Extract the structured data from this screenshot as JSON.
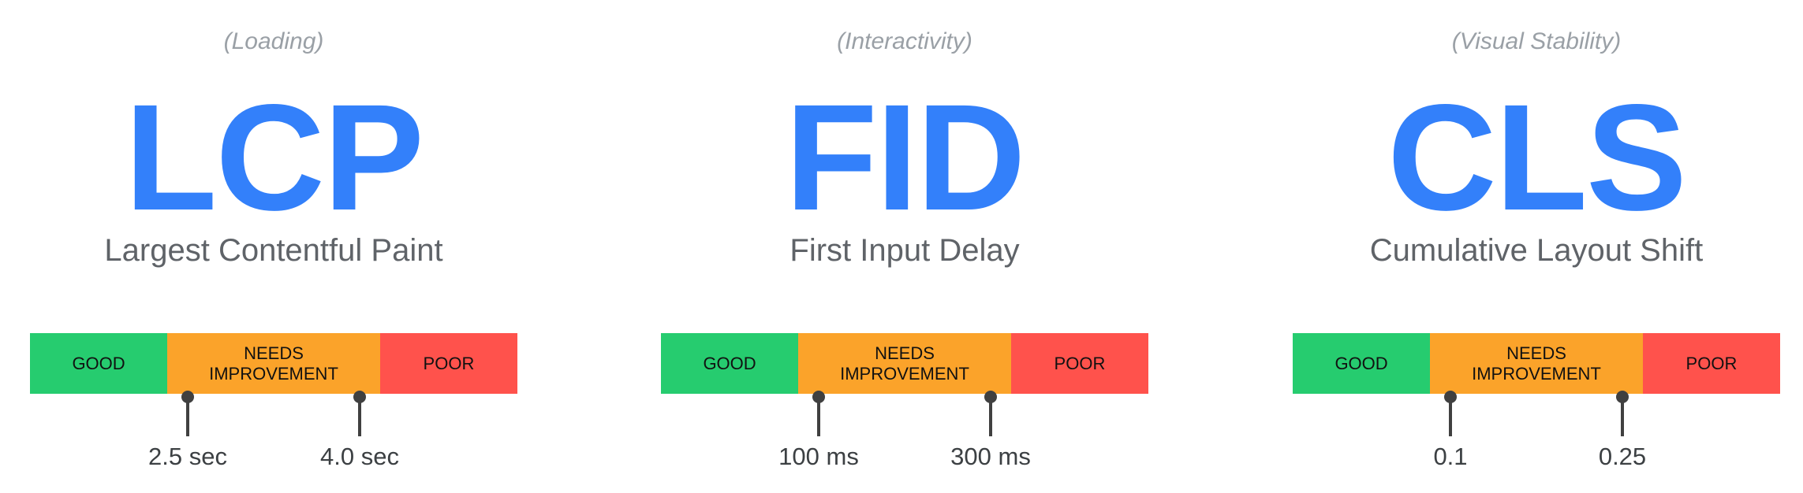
{
  "colors": {
    "good": "#26cc6f",
    "needs_improvement": "#fba32a",
    "poor": "#ff524c",
    "accent": "#3380fa"
  },
  "metrics": [
    {
      "category": "(Loading)",
      "abbr": "LCP",
      "name": "Largest Contentful Paint",
      "bands": [
        "GOOD",
        "NEEDS IMPROVEMENT",
        "POOR"
      ],
      "thresholds": [
        "2.5 sec",
        "4.0 sec"
      ]
    },
    {
      "category": "(Interactivity)",
      "abbr": "FID",
      "name": "First Input Delay",
      "bands": [
        "GOOD",
        "NEEDS IMPROVEMENT",
        "POOR"
      ],
      "thresholds": [
        "100 ms",
        "300 ms"
      ]
    },
    {
      "category": "(Visual Stability)",
      "abbr": "CLS",
      "name": "Cumulative Layout Shift",
      "bands": [
        "GOOD",
        "NEEDS IMPROVEMENT",
        "POOR"
      ],
      "thresholds": [
        "0.1",
        "0.25"
      ]
    }
  ]
}
